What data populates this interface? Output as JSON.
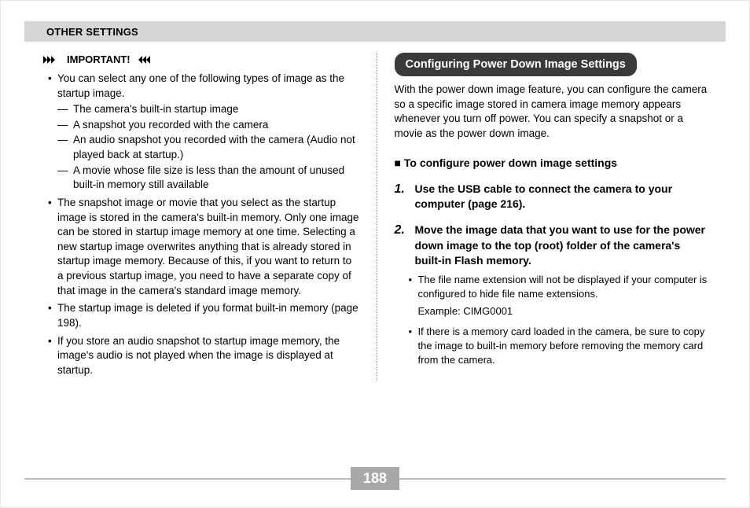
{
  "header": {
    "title": "OTHER SETTINGS"
  },
  "left": {
    "important_label": "IMPORTANT!",
    "bullets": [
      {
        "text": "You can select any one of the following types of image as the startup image.",
        "dashes": [
          "The camera's built-in startup image",
          "A snapshot you recorded with the camera",
          "An audio snapshot you recorded with the camera (Audio not played back at startup.)",
          "A movie whose file size is less than the amount of unused built-in memory still available"
        ]
      },
      {
        "text": "The snapshot image or movie that you select as the startup image is stored in the camera's built-in memory. Only one image can be stored in startup image memory at one time. Selecting a new startup image overwrites anything that is already stored in startup image memory. Because of this, if you want to return to a previous startup image, you need to have a separate copy of that image in the camera's standard image memory."
      },
      {
        "text": "The startup image is deleted if you format built-in memory (page 198)."
      },
      {
        "text": "If you store an audio snapshot to startup image memory, the image's audio is not played when the image is displayed at startup."
      }
    ]
  },
  "right": {
    "section_title": "Configuring Power Down Image Settings",
    "intro": "With the power down image feature, you can configure the camera so a specific image stored in camera image memory appears whenever you turn off power. You can specify a snapshot or a movie as the power down image.",
    "sub_marker": "■",
    "sub_title": "To configure power down image settings",
    "steps": [
      {
        "num": "1.",
        "text": "Use the USB cable to connect the camera to your computer (page 216)."
      },
      {
        "num": "2.",
        "text": "Move the image data that you want to use for the power down image to the top (root) folder of the camera's built-in Flash memory."
      }
    ],
    "sub_bullets": [
      "The file name extension will not be displayed if your computer is configured to hide file name extensions.",
      "If there is a memory card loaded in the camera, be sure to copy the image to built-in memory before removing the memory card from the camera."
    ],
    "example_label": "Example: CIMG0001"
  },
  "page_number": "188"
}
